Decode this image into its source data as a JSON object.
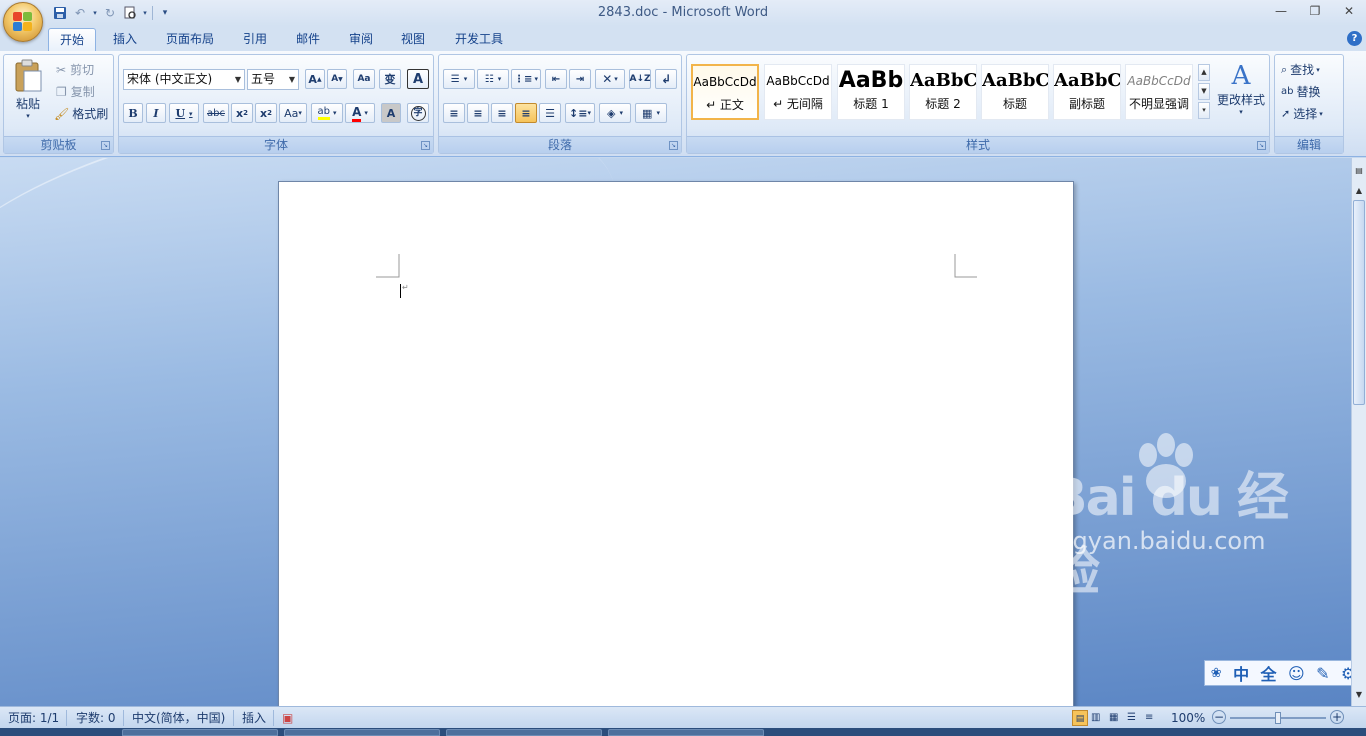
{
  "window": {
    "title": "2843.doc - Microsoft Word"
  },
  "tabs": [
    "开始",
    "插入",
    "页面布局",
    "引用",
    "邮件",
    "审阅",
    "视图",
    "开发工具"
  ],
  "clipboard": {
    "paste": "粘贴",
    "cut": "剪切",
    "copy": "复制",
    "format_painter": "格式刷",
    "label": "剪贴板"
  },
  "font": {
    "name": "宋体 (中文正文)",
    "size": "五号",
    "label": "字体"
  },
  "paragraph": {
    "label": "段落"
  },
  "styles": {
    "label": "样式",
    "items": [
      {
        "sample": "AaBbCcDd",
        "name": "↵ 正文"
      },
      {
        "sample": "AaBbCcDd",
        "name": "↵ 无间隔"
      },
      {
        "sample": "AaBb",
        "name": "标题 1"
      },
      {
        "sample": "AaBbC",
        "name": "标题 2"
      },
      {
        "sample": "AaBbC",
        "name": "标题"
      },
      {
        "sample": "AaBbC",
        "name": "副标题"
      },
      {
        "sample": "AaBbCcDd",
        "name": "不明显强调"
      }
    ],
    "change_styles": "更改样式"
  },
  "editing": {
    "find": "查找",
    "replace": "替换",
    "select": "选择",
    "label": "编辑"
  },
  "watermark": {
    "main": "Bai du 经验",
    "sub": "jingyan.baidu.com"
  },
  "ime": [
    "中",
    "全"
  ],
  "status": {
    "page": "页面: 1/1",
    "words": "字数: 0",
    "language": "中文(简体，中国)",
    "mode": "插入",
    "zoom": "100%"
  },
  "colors": {
    "accent": "#f2b44a",
    "highlight": "#ffff00",
    "font_color": "#ff0000"
  }
}
